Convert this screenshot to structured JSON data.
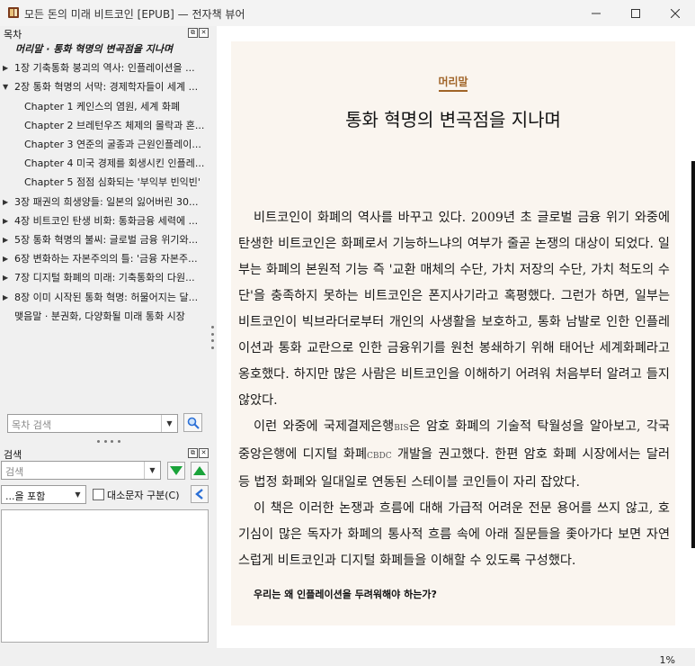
{
  "window": {
    "title": "모든 돈의 미래 비트코인 [EPUB] — 전자책 뷰어"
  },
  "toc_panel": {
    "header": "목차",
    "items": [
      {
        "label": "머리말 · 통화 혁명의 변곡점을 지나며",
        "level": 0,
        "expander": "",
        "current": true
      },
      {
        "label": "1장 기축통화 붕괴의 역사: 인플레이션을 ...",
        "level": 0,
        "expander": "▶",
        "current": false
      },
      {
        "label": "2장 통화 혁명의 서막: 경제학자들이 세계 ...",
        "level": 0,
        "expander": "▼",
        "current": false
      },
      {
        "label": "Chapter 1 케인스의 염원, 세계 화폐",
        "level": 1,
        "expander": "",
        "current": false
      },
      {
        "label": "Chapter 2 브레턴우즈 체제의 몰락과 혼...",
        "level": 1,
        "expander": "",
        "current": false
      },
      {
        "label": "Chapter 3 연준의 굴종과 근원인플레이...",
        "level": 1,
        "expander": "",
        "current": false
      },
      {
        "label": "Chapter 4 미국 경제를 회생시킨 인플레...",
        "level": 1,
        "expander": "",
        "current": false
      },
      {
        "label": "Chapter 5 점점 심화되는 '부익부 빈익빈'",
        "level": 1,
        "expander": "",
        "current": false
      },
      {
        "label": "3장 패권의 희생양들: 일본의 잃어버린 30...",
        "level": 0,
        "expander": "▶",
        "current": false
      },
      {
        "label": "4장 비트코인 탄생 비화: 통화금융 세력에 ...",
        "level": 0,
        "expander": "▶",
        "current": false
      },
      {
        "label": "5장 통화 혁명의 불씨: 글로벌 금융 위기와...",
        "level": 0,
        "expander": "▶",
        "current": false
      },
      {
        "label": "6장 변화하는 자본주의의 틀: '금융 자본주...",
        "level": 0,
        "expander": "▶",
        "current": false
      },
      {
        "label": "7장 디지털 화폐의 미래: 기축통화의 다원...",
        "level": 0,
        "expander": "▶",
        "current": false
      },
      {
        "label": "8장 이미 시작된 통화 혁명: 허물어지는 달...",
        "level": 0,
        "expander": "▶",
        "current": false
      },
      {
        "label": "맺음말 · 분권화, 다양화될 미래 통화 시장",
        "level": 0,
        "expander": "",
        "current": false
      }
    ],
    "search_placeholder": "목차 검색"
  },
  "search_panel": {
    "header": "검색",
    "input_placeholder": "검색",
    "mode_value": "...을 포함",
    "case_label": "대소문자 구분(C)",
    "case_checked": false
  },
  "reader": {
    "chapter_label": "머리말",
    "chapter_title": "통화 혁명의 변곡점을 지나며",
    "paragraphs": [
      {
        "a": "비트코인이 화폐의 역사를 바꾸고 있다. 2009년 초 글로벌 금융 위기 와중에 탄생한 비트코인은 화폐로서 기능하느냐의 여부가 줄곧 논쟁의 대상이 되었다. 일부는 화폐의 본원적 기능 즉 '교환 매체의 수단, 가치 저장의 수단, 가치 척도의 수단'을 충족하지 못하는 비트코인은 폰지사기라고 혹평했다. 그런가 하면, 일부는 비트코인이 빅브라더로부터 개인의 사생활을 보호하고, 통화 남발로 인한 인플레이션과 통화 교란으로 인한 금융위기를 원천 봉쇄하기 위해 태어난 세계화폐라고 옹호했다. 하지만 많은 사람은 비트코인을 이해하기 어려워 처음부터 알려고 들지 않았다."
      },
      {
        "a": "이런 와중에 국제결제은행",
        "s1": "BIS",
        "b": "은 암호 화폐의 기술적 탁월성을 알아보고, 각국 중앙은행에 디지털 화폐",
        "s2": "CBDC",
        "c": " 개발을 권고했다. 한편 암호 화폐 시장에서는 달러 등 법정 화폐와 일대일로 연동된 스테이블 코인들이 자리 잡았다."
      },
      {
        "a": "이 책은 이러한 논쟁과 흐름에 대해 가급적 어려운 전문 용어를 쓰지 않고, 호기심이 많은 독자가 화폐의 통사적 흐름 속에 아래 질문들을 좇아가다 보면 자연스럽게 비트코인과 디지털 화폐들을 이해할 수 있도록 구성했다."
      }
    ],
    "section_heading": "우리는 왜 인플레이션을 두려워해야 하는가?",
    "progress_label": "1%"
  },
  "colors": {
    "accent": "#a06428",
    "page_bg": "#faf5ef",
    "nav_green": "#1aa33a",
    "nav_blue": "#2a6fd6"
  }
}
